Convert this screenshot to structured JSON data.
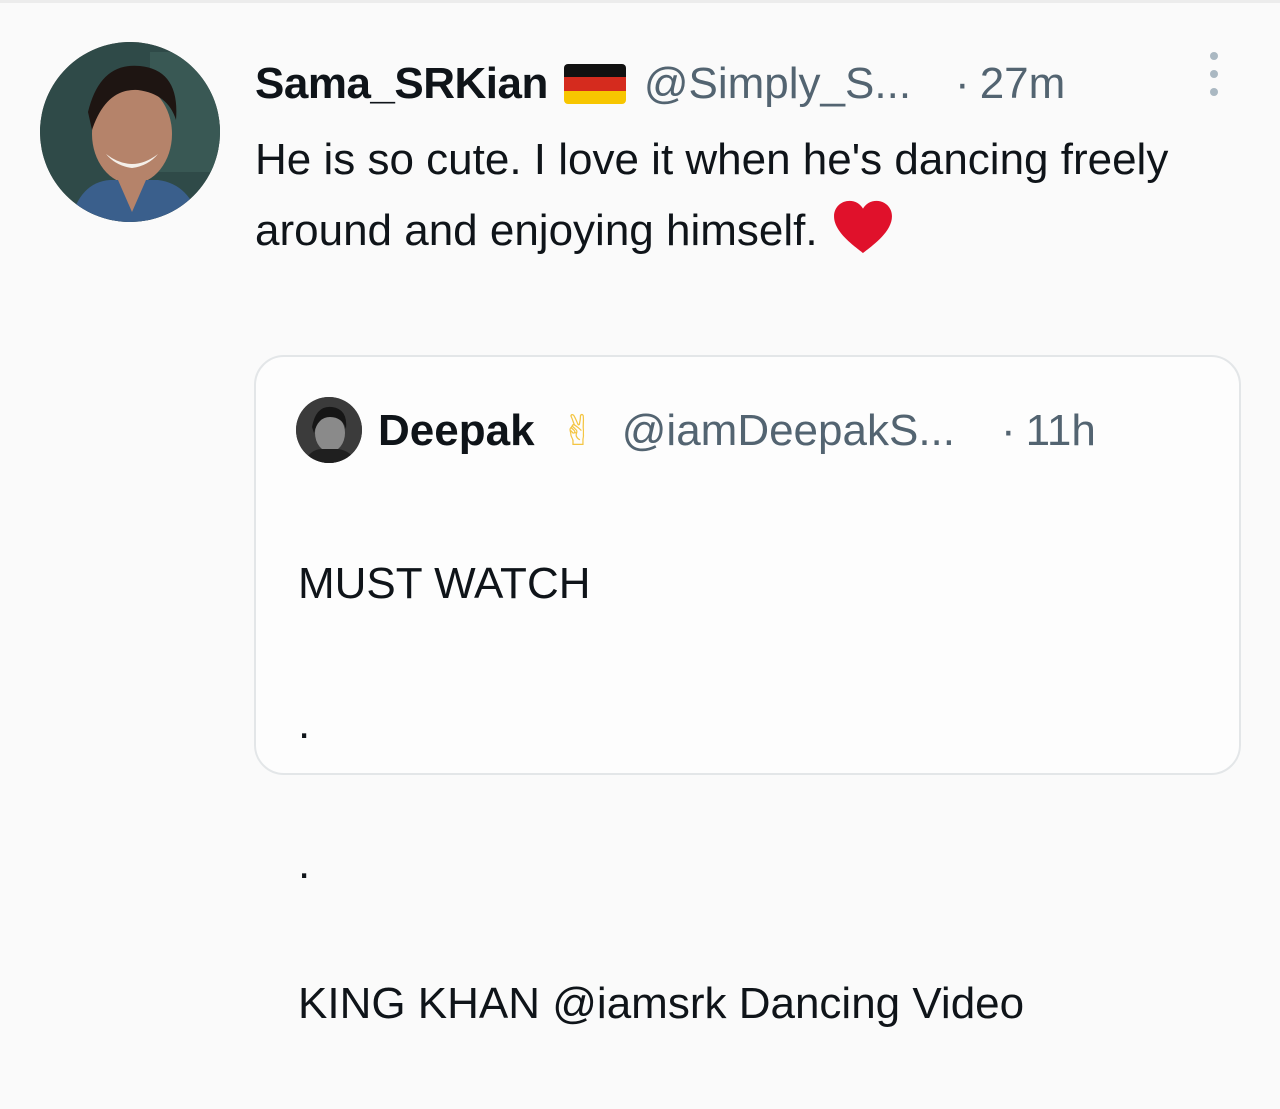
{
  "tweet": {
    "display_name": "Sama_SRKian",
    "flag": "germany-flag-icon",
    "handle": "@Simply_S...",
    "separator": "·",
    "time": "27m",
    "text": "He is so cute. I love it when he's dancing freely around and enjoying himself.",
    "emoji": "heart-icon",
    "heart_color": "#e0112b"
  },
  "quoted": {
    "display_name": "Deepak",
    "badge": "✌",
    "handle": "@iamDeepakS...",
    "separator": "·",
    "time": "11h",
    "line1": "MUST WATCH",
    "line2": ".",
    "line3": ".",
    "line4": "KING KHAN @iamsrk Dancing Video"
  }
}
